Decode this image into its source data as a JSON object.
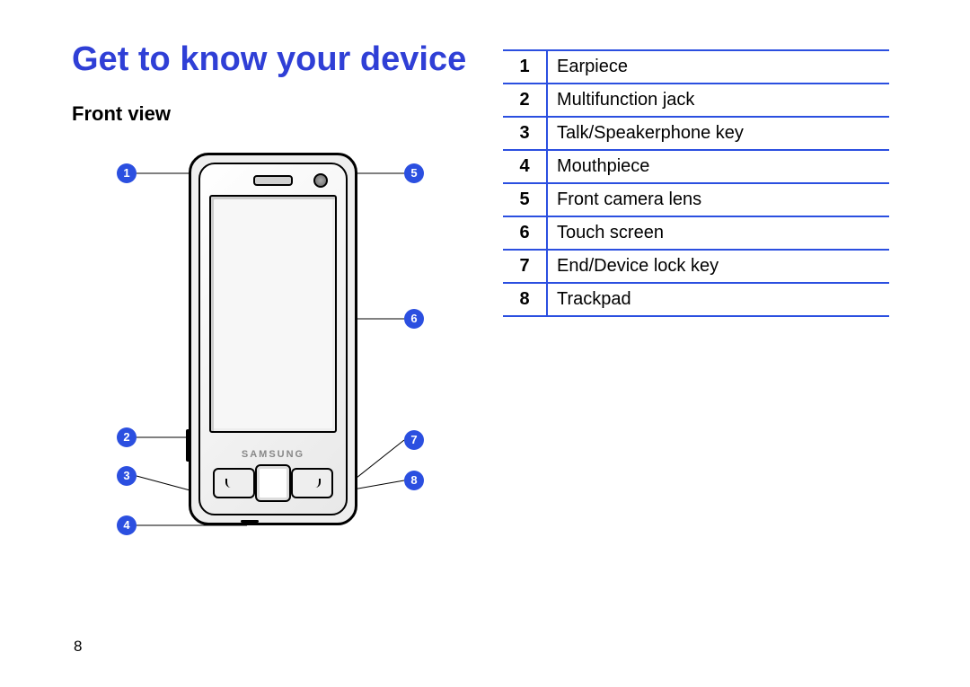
{
  "title": "Get to know your device",
  "section": "Front view",
  "page_number": "8",
  "brand": "SAMSUNG",
  "callouts": {
    "1": "1",
    "2": "2",
    "3": "3",
    "4": "4",
    "5": "5",
    "6": "6",
    "7": "7",
    "8": "8"
  },
  "legend": [
    {
      "num": "1",
      "label": "Earpiece"
    },
    {
      "num": "2",
      "label": "Multifunction jack"
    },
    {
      "num": "3",
      "label": "Talk/Speakerphone key"
    },
    {
      "num": "4",
      "label": "Mouthpiece"
    },
    {
      "num": "5",
      "label": "Front camera lens"
    },
    {
      "num": "6",
      "label": "Touch screen"
    },
    {
      "num": "7",
      "label": "End/Device lock key"
    },
    {
      "num": "8",
      "label": "Trackpad"
    }
  ]
}
